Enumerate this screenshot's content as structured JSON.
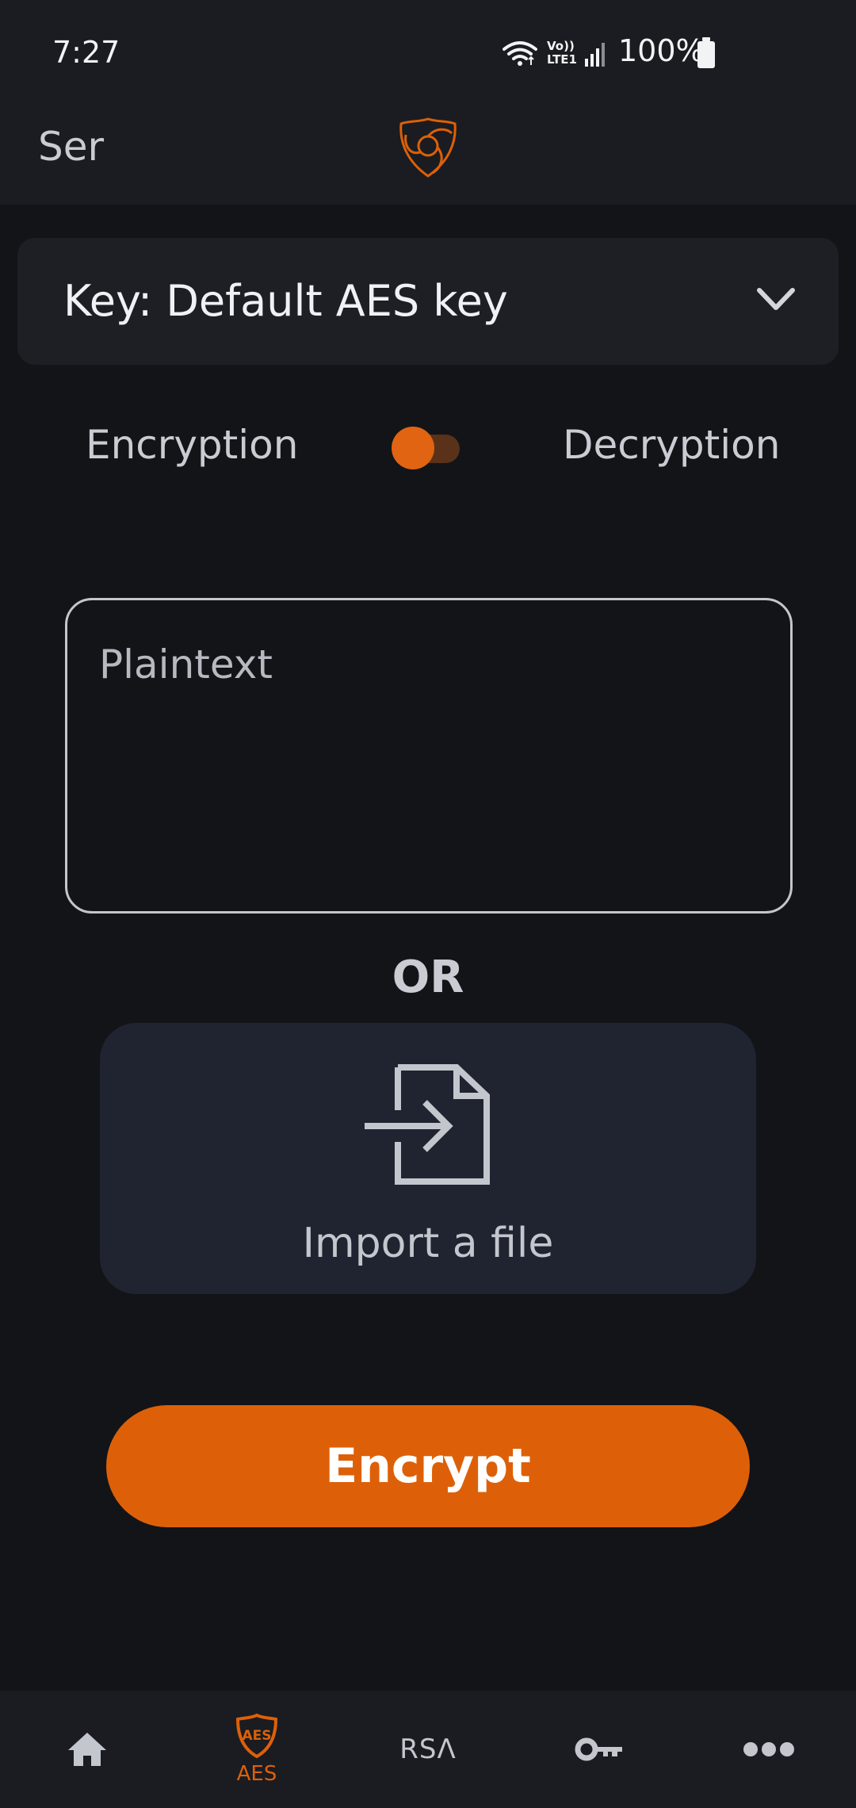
{
  "status_bar": {
    "time": "7:27",
    "battery": "100%",
    "network_label": "Vo)) LTE1"
  },
  "app_bar": {
    "title": "Ser",
    "logo_icon": "shield-vortex-logo"
  },
  "key_selector": {
    "label": "Key: Default AES key"
  },
  "mode": {
    "left_label": "Encryption",
    "right_label": "Decryption",
    "selected": "Encryption"
  },
  "plaintext": {
    "placeholder": "Plaintext",
    "value": ""
  },
  "or_label": "OR",
  "import_card": {
    "label": "Import a file",
    "icon": "file-import-icon"
  },
  "encrypt_button": {
    "label": "Encrypt"
  },
  "bottom_nav": {
    "items": [
      {
        "id": "home",
        "icon": "home-icon",
        "label": ""
      },
      {
        "id": "aes",
        "icon": "aes-shield-icon",
        "label": "AES",
        "active": true
      },
      {
        "id": "rsa",
        "icon": "rsa-icon",
        "label": ""
      },
      {
        "id": "keys",
        "icon": "key-icon",
        "label": ""
      },
      {
        "id": "more",
        "icon": "more-icon",
        "label": ""
      }
    ],
    "rsa_icon_text": "RSΛ",
    "aes_badge_text": "AES"
  },
  "colors": {
    "accent": "#dd6008",
    "background": "#131418",
    "surface": "#1d1f25",
    "card": "#1f2430"
  }
}
